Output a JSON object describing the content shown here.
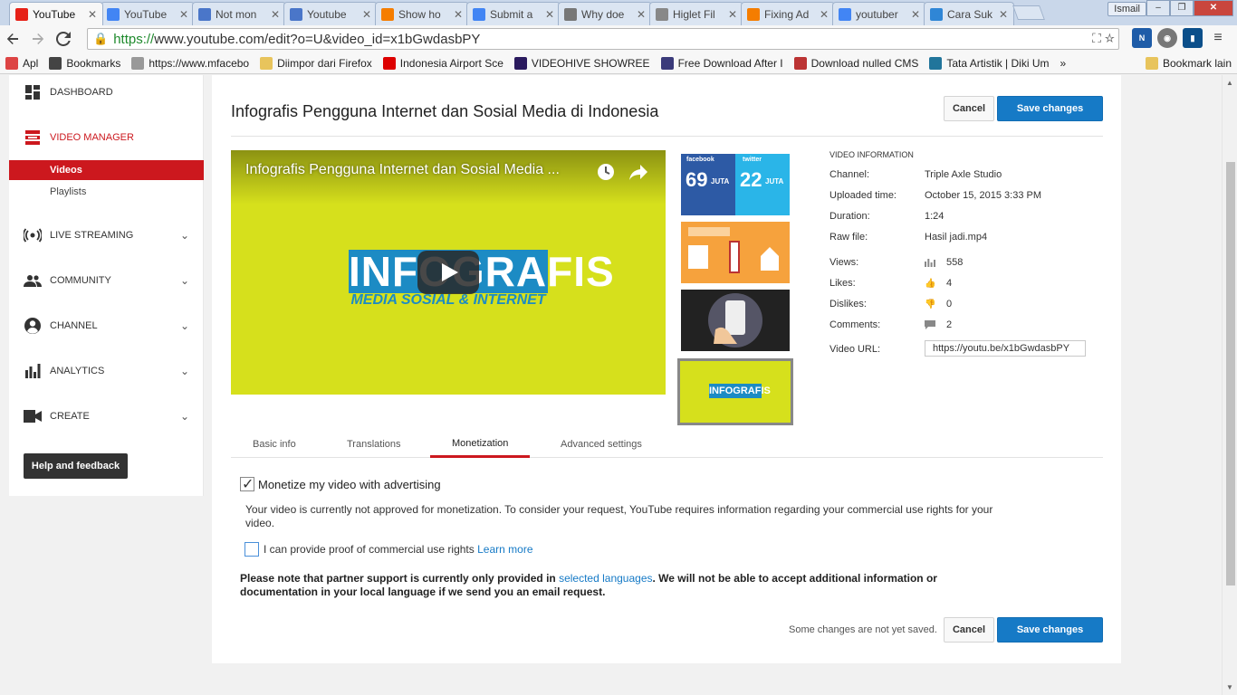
{
  "browser": {
    "tabs": [
      {
        "label": "YouTube",
        "favicon": "youtube-icon",
        "color": "#e62117",
        "active": true
      },
      {
        "label": "YouTube",
        "favicon": "google-icon",
        "color": "#4285f4"
      },
      {
        "label": "Not mon",
        "favicon": "doc-icon",
        "color": "#4a76c9"
      },
      {
        "label": "Youtube",
        "favicon": "doc-icon",
        "color": "#4a76c9"
      },
      {
        "label": "Show ho",
        "favicon": "blogger-icon",
        "color": "#f57d00"
      },
      {
        "label": "Submit a",
        "favicon": "google-icon",
        "color": "#4285f4"
      },
      {
        "label": "Why doe",
        "favicon": "reddit-icon",
        "color": "#777777"
      },
      {
        "label": "Higlet Fil",
        "favicon": "file-icon",
        "color": "#888888"
      },
      {
        "label": "Fixing Ad",
        "favicon": "blogger-icon",
        "color": "#f57d00"
      },
      {
        "label": "youtuber",
        "favicon": "google-icon",
        "color": "#4285f4"
      },
      {
        "label": "Cara Suk",
        "favicon": "k-icon",
        "color": "#2f86d6"
      }
    ],
    "user": "Ismail",
    "url_https": "https://",
    "url_rest": "www.youtube.com/edit?o=U&video_id=x1bGwdasbPY",
    "bookmarks": [
      {
        "label": "Apl",
        "icon": "apps-icon",
        "color": "#d44"
      },
      {
        "label": "Bookmarks",
        "icon": "star-icon",
        "color": "#444"
      },
      {
        "label": "https://www.mfacebo",
        "icon": "page-icon",
        "color": "#999"
      },
      {
        "label": "Diimpor dari Firefox",
        "icon": "folder-icon",
        "color": "#e8c45c"
      },
      {
        "label": "Indonesia Airport Sce",
        "icon": "flag-icon",
        "color": "#d00"
      },
      {
        "label": "VIDEOHIVE SHOWREE",
        "icon": "ae-icon",
        "color": "#2a1a5e"
      },
      {
        "label": "Free Download After I",
        "icon": "ae-icon",
        "color": "#3a3a7a"
      },
      {
        "label": "Download nulled CMS",
        "icon": "t-icon",
        "color": "#b33"
      },
      {
        "label": "Tata Artistik | Diki Um",
        "icon": "wordpress-icon",
        "color": "#21759b"
      },
      {
        "label": "»",
        "icon": "",
        "color": ""
      },
      {
        "label": "Bookmark lain",
        "icon": "folder-icon",
        "color": "#e8c45c"
      }
    ]
  },
  "sidebar": {
    "dashboard": "DASHBOARD",
    "video_manager": "VIDEO MANAGER",
    "videos": "Videos",
    "playlists": "Playlists",
    "live_streaming": "LIVE STREAMING",
    "community": "COMMUNITY",
    "channel": "CHANNEL",
    "analytics": "ANALYTICS",
    "create": "CREATE",
    "help": "Help and feedback"
  },
  "main": {
    "title": "Infografis Pengguna Internet dan Sosial Media di Indonesia",
    "cancel": "Cancel",
    "save": "Save changes",
    "player_title": "Infografis Pengguna Internet dan Sosial Media ...",
    "logo_main": "INFOGRAFIS",
    "logo_sub": "MEDIA SOSIAL & INTERNET",
    "thumb1": {
      "left_brand": "facebook",
      "left_num": "69",
      "right_brand": "twitter",
      "right_num": "22",
      "unit": "JUTA"
    },
    "thumb4_text": "INFOGRAFIS"
  },
  "info": {
    "header": "VIDEO INFORMATION",
    "channel_label": "Channel:",
    "channel": "Triple Axle Studio",
    "uploaded_label": "Uploaded time:",
    "uploaded": "October 15, 2015 3:33 PM",
    "duration_label": "Duration:",
    "duration": "1:24",
    "raw_label": "Raw file:",
    "raw": "Hasil jadi.mp4",
    "views_label": "Views:",
    "views": "558",
    "likes_label": "Likes:",
    "likes": "4",
    "dislikes_label": "Dislikes:",
    "dislikes": "0",
    "comments_label": "Comments:",
    "comments": "2",
    "url_label": "Video URL:",
    "url": "https://youtu.be/x1bGwdasbPY"
  },
  "tabs": {
    "basic": "Basic info",
    "translations": "Translations",
    "monetization": "Monetization",
    "advanced": "Advanced settings"
  },
  "monetization": {
    "monetize_label": "Monetize my video with advertising",
    "monetize_checked": true,
    "status_text": "Your video is currently not approved for monetization. To consider your request, YouTube requires information regarding your commercial use rights for your video.",
    "proof_label": "I can provide proof of commercial use rights",
    "learn_more": "Learn more",
    "note_pre": "Please note that partner support is currently only provided in",
    "note_link": "selected languages",
    "note_post": ". We will not be able to accept additional information or documentation in your local language if we send you an email request.",
    "unsaved": "Some changes are not yet saved."
  }
}
